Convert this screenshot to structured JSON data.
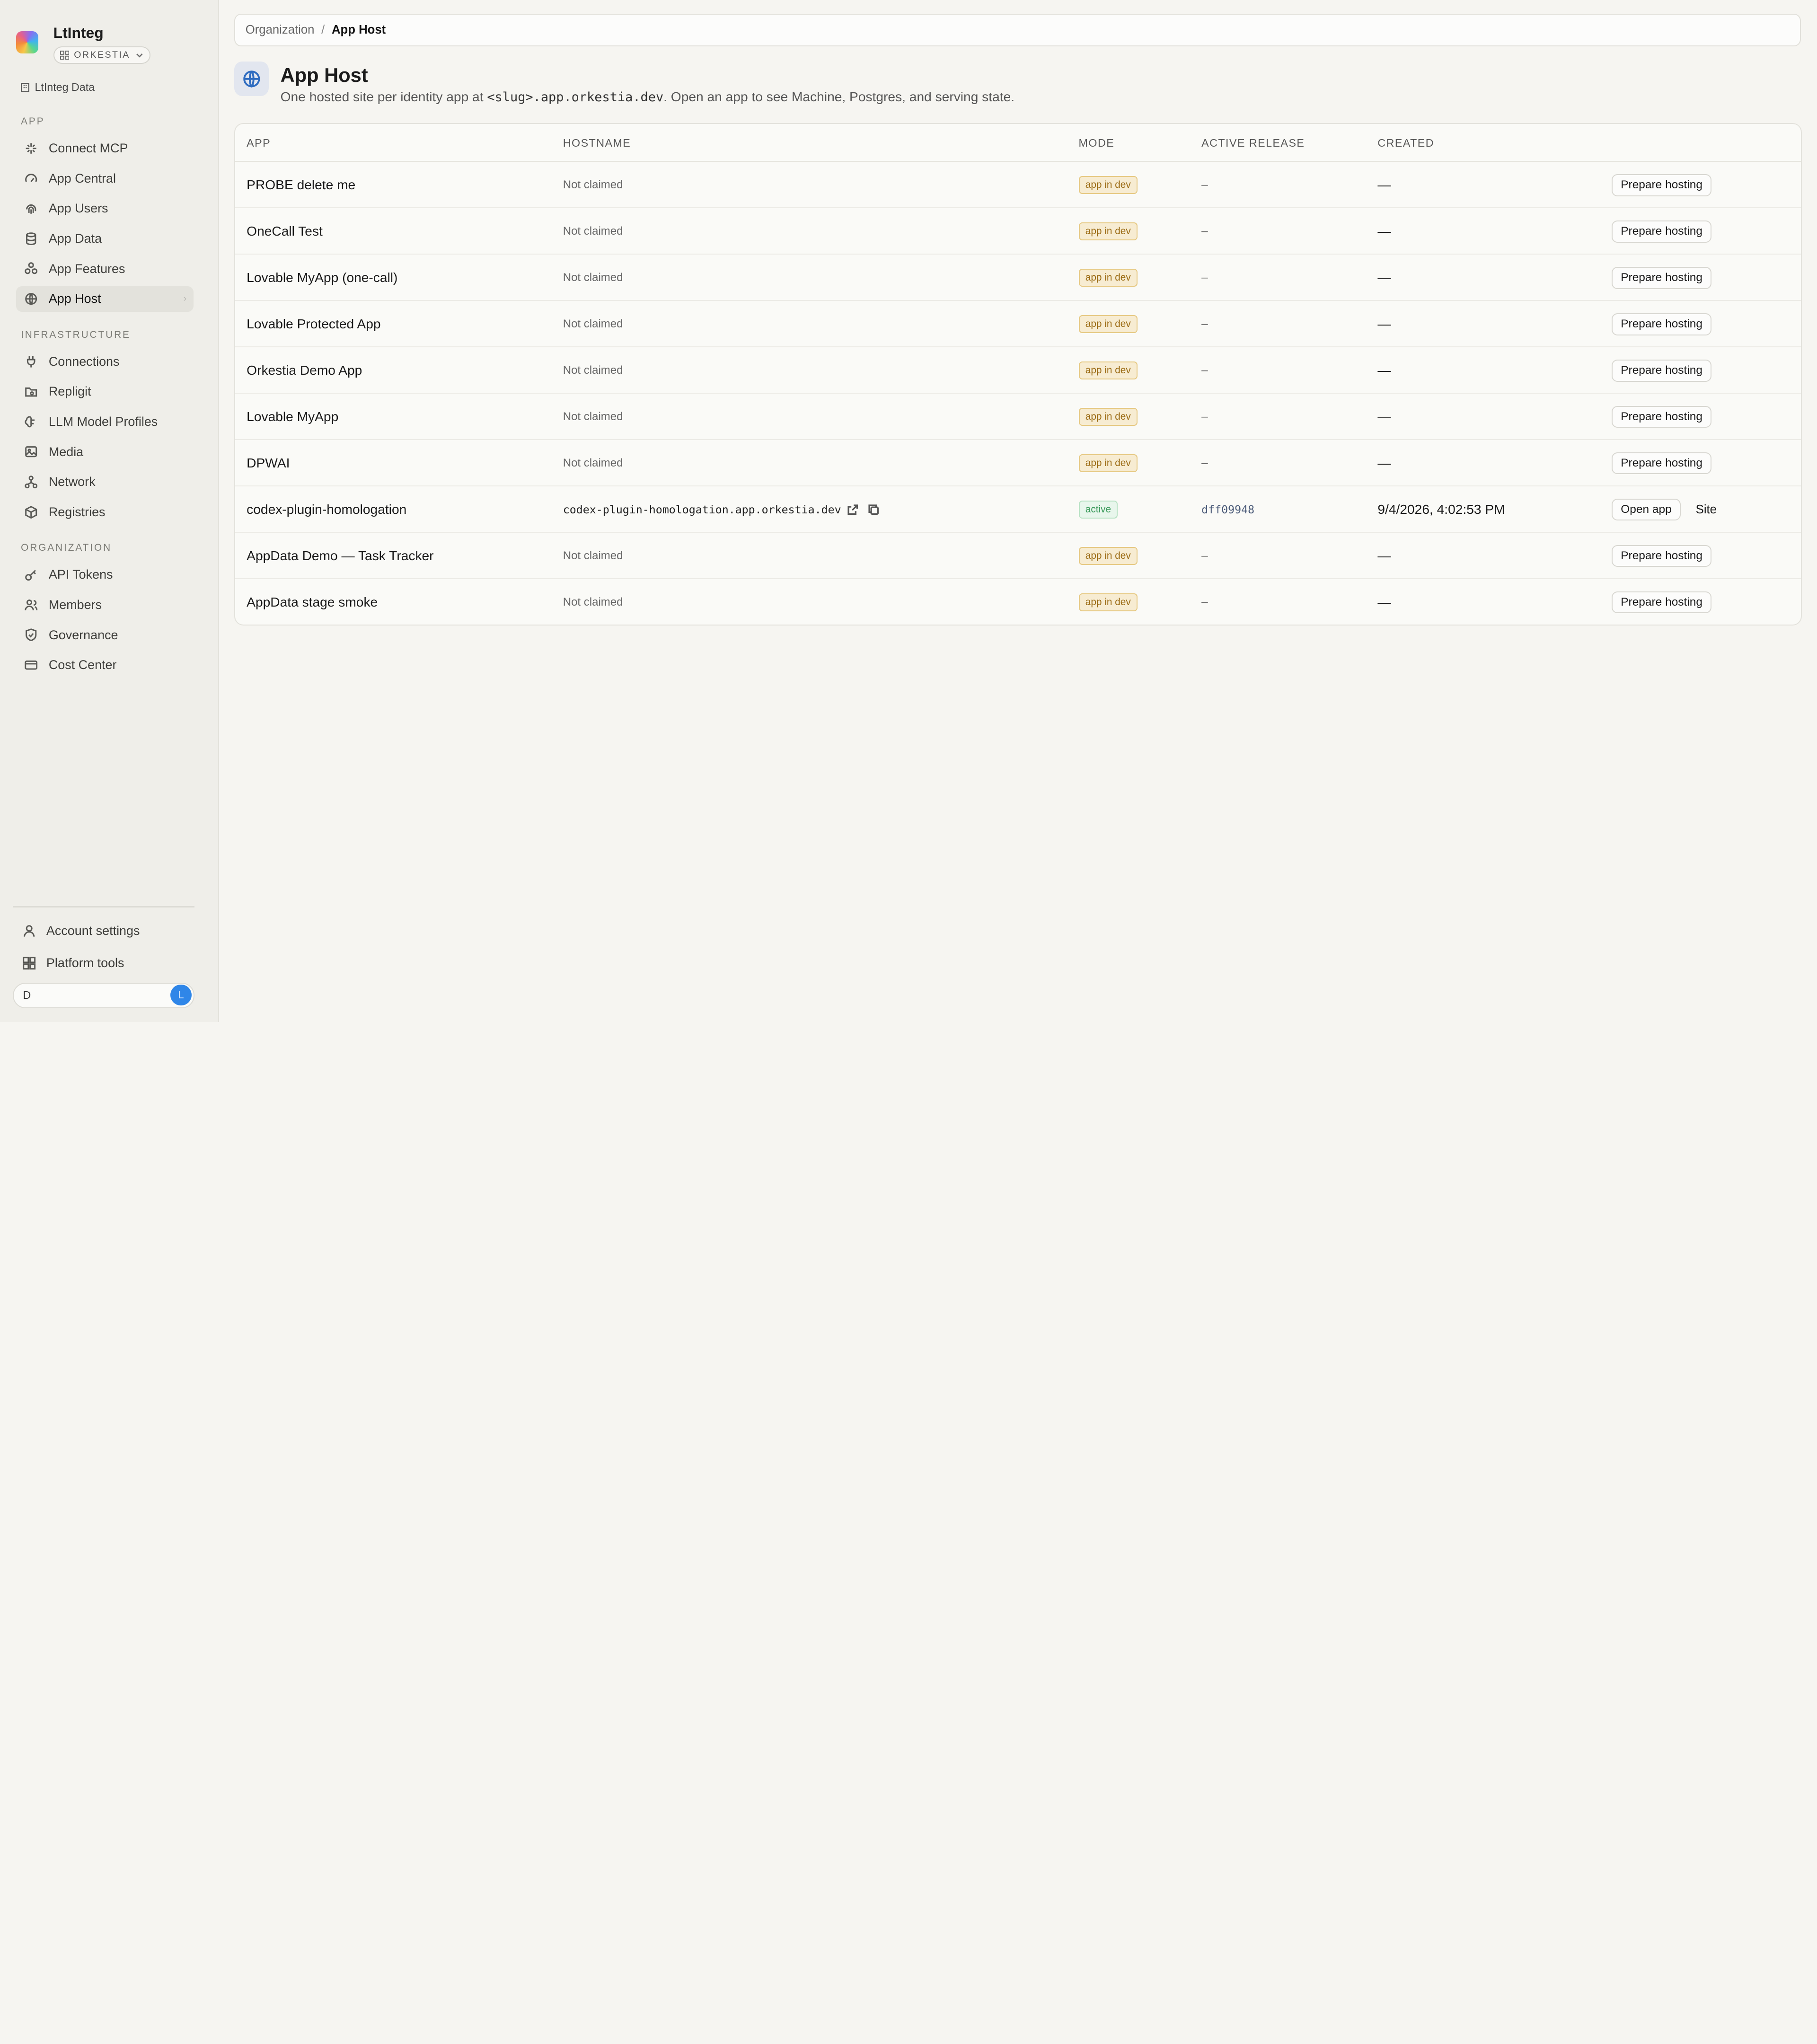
{
  "workspace": {
    "name": "LtInteg",
    "org": "ORKESTIA",
    "data_link": "LtInteg Data"
  },
  "sidebar": {
    "sections": [
      {
        "title": "APP",
        "items": [
          "Connect MCP",
          "App Central",
          "App Users",
          "App Data",
          "App Features",
          "App Host"
        ]
      },
      {
        "title": "INFRASTRUCTURE",
        "items": [
          "Connections",
          "Repligit",
          "LLM Model Profiles",
          "Media",
          "Network",
          "Registries"
        ]
      },
      {
        "title": "ORGANIZATION",
        "items": [
          "API Tokens",
          "Members",
          "Governance",
          "Cost Center"
        ]
      }
    ],
    "active_item": "App Host",
    "bottom": {
      "account": "Account settings",
      "platform": "Platform tools",
      "user_input": "D",
      "avatar": "L"
    }
  },
  "breadcrumb": {
    "root": "Organization",
    "sep": "/",
    "current": "App Host"
  },
  "page": {
    "title": "App Host",
    "desc_pre": "One hosted site per identity app at ",
    "desc_code": "<slug>.app.orkestia.dev",
    "desc_post": ". Open an app to see Machine, Postgres, and serving state."
  },
  "table": {
    "columns": [
      "APP",
      "HOSTNAME",
      "MODE",
      "ACTIVE RELEASE",
      "CREATED"
    ],
    "rows": [
      {
        "app": "PROBE delete me",
        "hostname": "Not claimed",
        "mode": "app in dev",
        "release": "–",
        "created": "—",
        "actions": [
          "Prepare hosting"
        ]
      },
      {
        "app": "OneCall Test",
        "hostname": "Not claimed",
        "mode": "app in dev",
        "release": "–",
        "created": "—",
        "actions": [
          "Prepare hosting"
        ]
      },
      {
        "app": "Lovable MyApp (one-call)",
        "hostname": "Not claimed",
        "mode": "app in dev",
        "release": "–",
        "created": "—",
        "actions": [
          "Prepare hosting"
        ]
      },
      {
        "app": "Lovable Protected App",
        "hostname": "Not claimed",
        "mode": "app in dev",
        "release": "–",
        "created": "—",
        "actions": [
          "Prepare hosting"
        ]
      },
      {
        "app": "Orkestia Demo App",
        "hostname": "Not claimed",
        "mode": "app in dev",
        "release": "–",
        "created": "—",
        "actions": [
          "Prepare hosting"
        ]
      },
      {
        "app": "Lovable MyApp",
        "hostname": "Not claimed",
        "mode": "app in dev",
        "release": "–",
        "created": "—",
        "actions": [
          "Prepare hosting"
        ]
      },
      {
        "app": "DPWAI",
        "hostname": "Not claimed",
        "mode": "app in dev",
        "release": "–",
        "created": "—",
        "actions": [
          "Prepare hosting"
        ]
      },
      {
        "app": "codex-plugin-homologation",
        "hostname": "codex-plugin-homologation.app.orkestia.dev",
        "mode": "active",
        "release": "dff09948",
        "created": "9/4/2026, 4:02:53 PM",
        "actions": [
          "Open app",
          "Site"
        ]
      },
      {
        "app": "AppData Demo — Task Tracker",
        "hostname": "Not claimed",
        "mode": "app in dev",
        "release": "–",
        "created": "—",
        "actions": [
          "Prepare hosting"
        ]
      },
      {
        "app": "AppData stage smoke",
        "hostname": "Not claimed",
        "mode": "app in dev",
        "release": "–",
        "created": "—",
        "actions": [
          "Prepare hosting"
        ]
      }
    ]
  }
}
